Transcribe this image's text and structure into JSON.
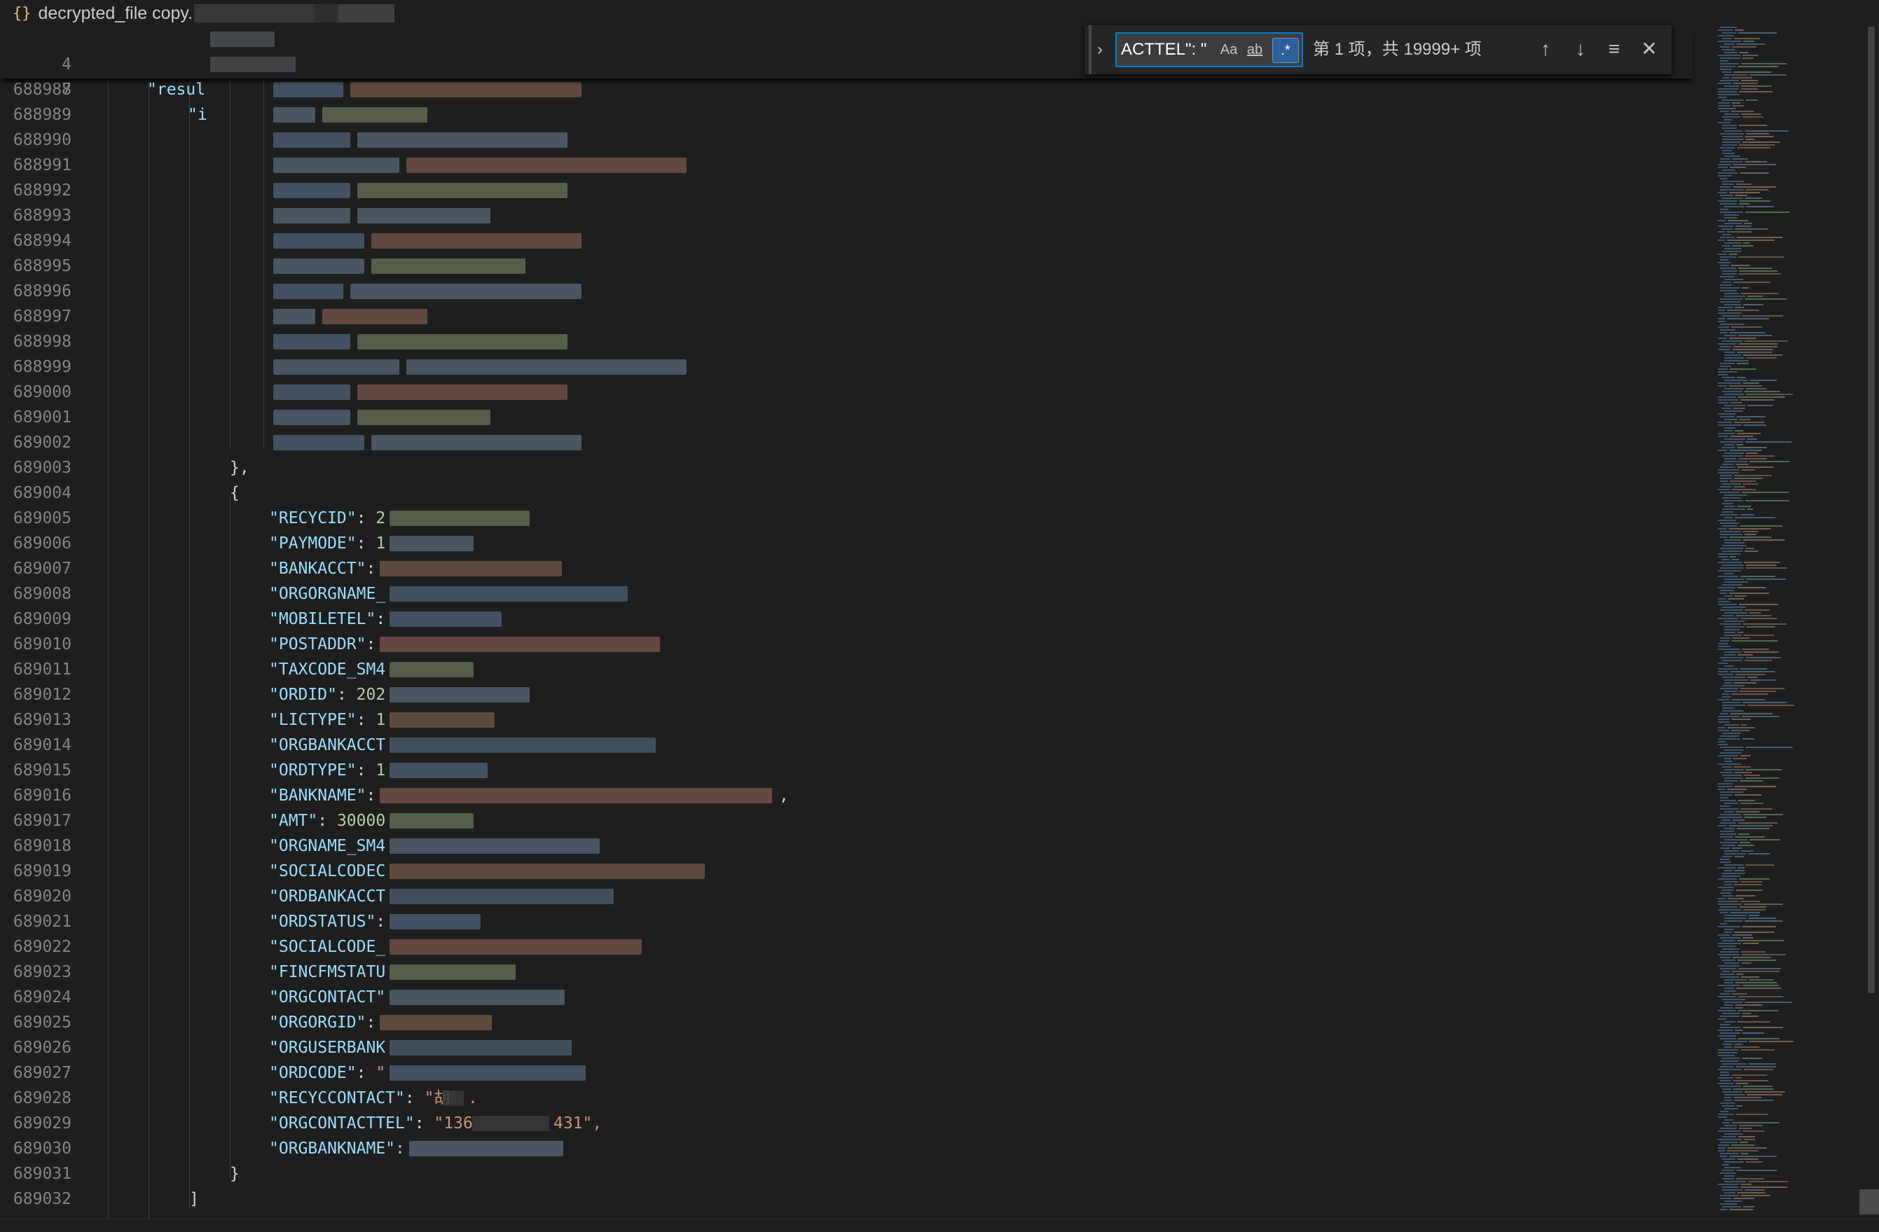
{
  "breadcrumb": {
    "icon": "{}",
    "file_name": "decrypted_file copy."
  },
  "sticky_lines": [
    {
      "num": "4",
      "text": "\"resul"
    },
    {
      "num": "7",
      "text": "\"i"
    }
  ],
  "redacted_lines": [
    "688988",
    "688989",
    "688990",
    "688991",
    "688992",
    "688993",
    "688994",
    "688995",
    "688996",
    "688997",
    "688998",
    "688999",
    "689000",
    "689001",
    "689002"
  ],
  "code_lines": [
    {
      "num": "689003",
      "parts": [
        {
          "t": "pun",
          "v": "},"
        }
      ]
    },
    {
      "num": "689004",
      "parts": [
        {
          "t": "pun",
          "v": "{"
        }
      ]
    },
    {
      "num": "689005",
      "parts": [
        {
          "t": "key",
          "v": "\"RECYCID\""
        },
        {
          "t": "pun",
          "v": ": "
        },
        {
          "t": "num",
          "v": "2"
        }
      ]
    },
    {
      "num": "689006",
      "parts": [
        {
          "t": "key",
          "v": "\"PAYMODE\""
        },
        {
          "t": "pun",
          "v": ": "
        },
        {
          "t": "num",
          "v": "1"
        }
      ]
    },
    {
      "num": "689007",
      "parts": [
        {
          "t": "key",
          "v": "\"BANKACCT\""
        },
        {
          "t": "pun",
          "v": ":"
        }
      ]
    },
    {
      "num": "689008",
      "parts": [
        {
          "t": "key",
          "v": "\"ORGORGNAME_"
        }
      ]
    },
    {
      "num": "689009",
      "parts": [
        {
          "t": "key",
          "v": "\"MOBILETEL\""
        },
        {
          "t": "pun",
          "v": ":"
        }
      ]
    },
    {
      "num": "689010",
      "parts": [
        {
          "t": "key",
          "v": "\"POSTADDR\""
        },
        {
          "t": "pun",
          "v": ":"
        }
      ]
    },
    {
      "num": "689011",
      "parts": [
        {
          "t": "key",
          "v": "\"TAXCODE_SM4"
        }
      ]
    },
    {
      "num": "689012",
      "parts": [
        {
          "t": "key",
          "v": "\"ORDID\""
        },
        {
          "t": "pun",
          "v": ": "
        },
        {
          "t": "num",
          "v": "202"
        }
      ]
    },
    {
      "num": "689013",
      "parts": [
        {
          "t": "key",
          "v": "\"LICTYPE\""
        },
        {
          "t": "pun",
          "v": ": "
        },
        {
          "t": "num",
          "v": "1"
        }
      ]
    },
    {
      "num": "689014",
      "parts": [
        {
          "t": "key",
          "v": "\"ORGBANKACCT"
        }
      ]
    },
    {
      "num": "689015",
      "parts": [
        {
          "t": "key",
          "v": "\"ORDTYPE\""
        },
        {
          "t": "pun",
          "v": ": "
        },
        {
          "t": "num",
          "v": "1"
        }
      ]
    },
    {
      "num": "689016",
      "parts": [
        {
          "t": "key",
          "v": "\"BANKNAME\""
        },
        {
          "t": "pun",
          "v": ":"
        }
      ]
    },
    {
      "num": "689017",
      "parts": [
        {
          "t": "key",
          "v": "\"AMT\""
        },
        {
          "t": "pun",
          "v": ": "
        },
        {
          "t": "num",
          "v": "30000"
        }
      ]
    },
    {
      "num": "689018",
      "parts": [
        {
          "t": "key",
          "v": "\"ORGNAME_SM4"
        }
      ]
    },
    {
      "num": "689019",
      "parts": [
        {
          "t": "key",
          "v": "\"SOCIALCODEC"
        }
      ]
    },
    {
      "num": "689020",
      "parts": [
        {
          "t": "key",
          "v": "\"ORDBANKACCT"
        }
      ]
    },
    {
      "num": "689021",
      "parts": [
        {
          "t": "key",
          "v": "\"ORDSTATUS\""
        },
        {
          "t": "pun",
          "v": ":"
        }
      ]
    },
    {
      "num": "689022",
      "parts": [
        {
          "t": "key",
          "v": "\"SOCIALCODE_"
        }
      ]
    },
    {
      "num": "689023",
      "parts": [
        {
          "t": "key",
          "v": "\"FINCFMSTATU"
        }
      ]
    },
    {
      "num": "689024",
      "parts": [
        {
          "t": "key",
          "v": "\"ORGCONTACT\""
        }
      ]
    },
    {
      "num": "689025",
      "parts": [
        {
          "t": "key",
          "v": "\"ORGORGID\""
        },
        {
          "t": "pun",
          "v": ":"
        }
      ]
    },
    {
      "num": "689026",
      "parts": [
        {
          "t": "key",
          "v": "\"ORGUSERBANK"
        }
      ]
    },
    {
      "num": "689027",
      "parts": [
        {
          "t": "key",
          "v": "\"ORDCODE\""
        },
        {
          "t": "pun",
          "v": ": "
        },
        {
          "t": "str",
          "v": "\""
        }
      ]
    },
    {
      "num": "689028",
      "parts": [
        {
          "t": "key",
          "v": "\"RECYCCONTACT\""
        },
        {
          "t": "pun",
          "v": ": "
        },
        {
          "t": "str",
          "v": "\"胡"
        }
      ]
    },
    {
      "num": "689029",
      "parts": [
        {
          "t": "key",
          "v": "\"ORGCONTACTTEL\""
        },
        {
          "t": "pun",
          "v": ": "
        },
        {
          "t": "str",
          "v": "\"136"
        }
      ]
    },
    {
      "num": "689030",
      "parts": [
        {
          "t": "key",
          "v": "\"ORGBANKNAME\""
        },
        {
          "t": "pun",
          "v": ":"
        }
      ]
    },
    {
      "num": "689031",
      "parts": [
        {
          "t": "pun",
          "v": "}"
        }
      ]
    },
    {
      "num": "689032",
      "parts": [
        {
          "t": "pun",
          "v": "]"
        }
      ]
    }
  ],
  "trailing_fragments": {
    "bankname_comma": ",",
    "recyccontact_tail": ".",
    "orgcontacttel_tail": "431\","
  },
  "find": {
    "query": "ACTTEL\": \"",
    "match_case_label": "Aa",
    "whole_word_label": "ab",
    "regex_label": ".*",
    "status": "第 1 项，共 19999+ 项"
  },
  "colors": {
    "editor_bg": "#1e1e1e",
    "key": "#9cdcfe",
    "string": "#ce9178",
    "number": "#b5cea8",
    "line_number": "#858585",
    "find_border": "#007fd4"
  }
}
